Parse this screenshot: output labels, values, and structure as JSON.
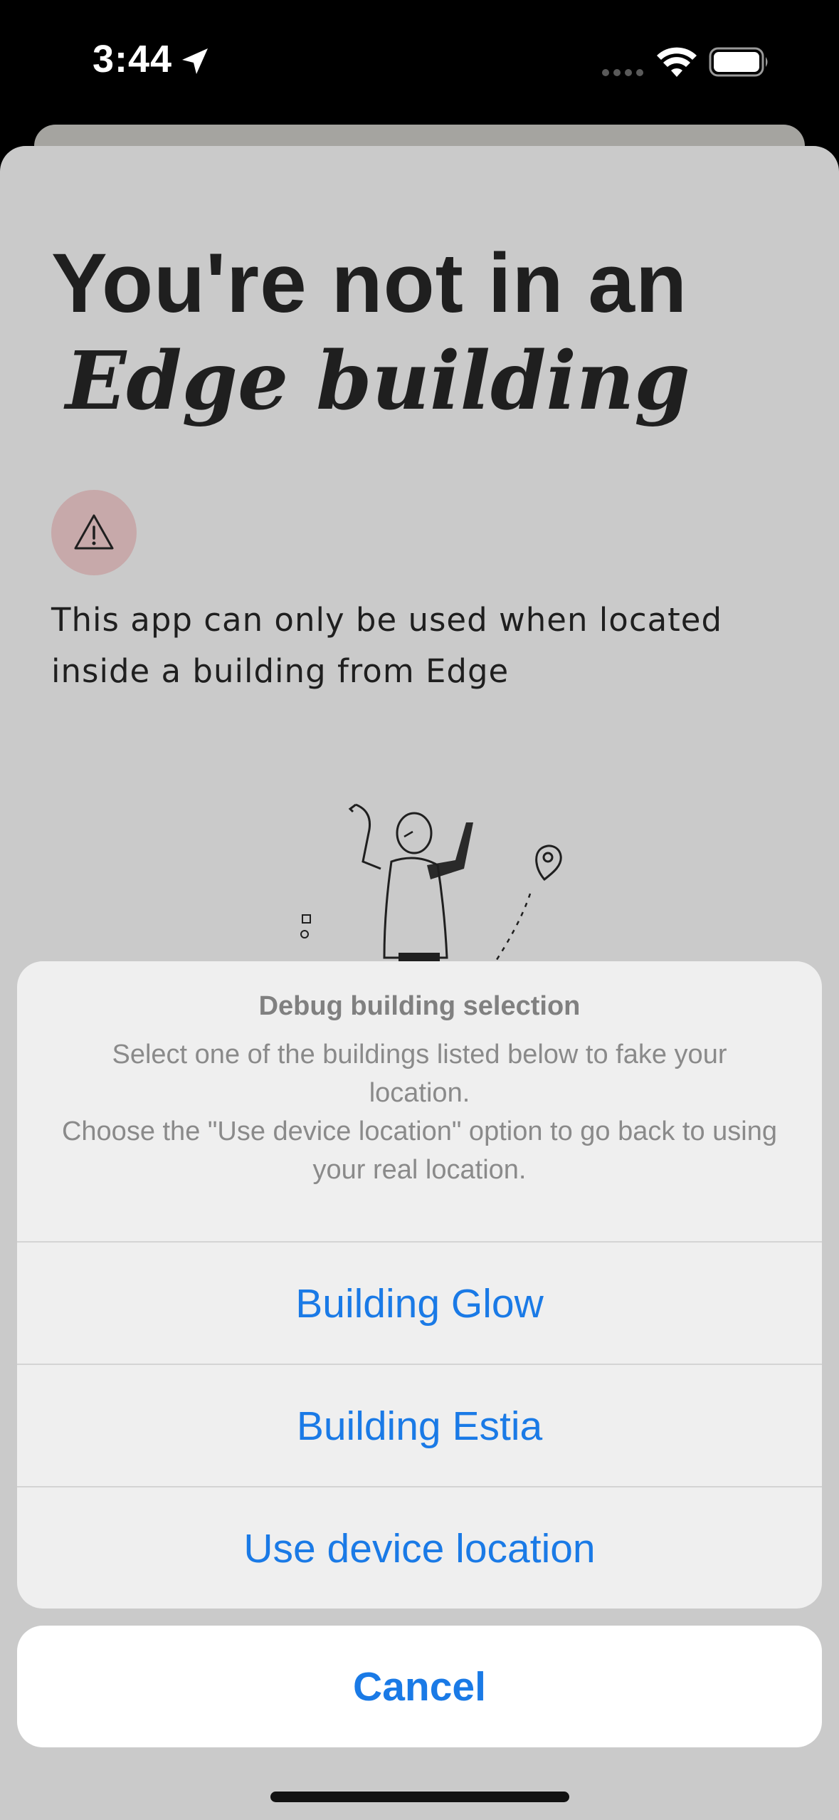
{
  "status_bar": {
    "time": "3:44"
  },
  "main": {
    "headline_line1": "You're not in an",
    "headline_line2": "Edge building",
    "warning_icon": "warning-triangle-icon",
    "info_text": "This app can only be used when located inside a building from Edge",
    "illustration": "person-shrugging-with-location-pin-illustration"
  },
  "action_sheet": {
    "title": "Debug building selection",
    "message_line1": "Select one of the buildings listed below to fake your location.",
    "message_line2": "Choose the \"Use device location\" option to go back to using your real location.",
    "options": [
      {
        "label": "Building Glow"
      },
      {
        "label": "Building Estia"
      },
      {
        "label": "Use device location"
      }
    ],
    "cancel_label": "Cancel"
  },
  "colors": {
    "accent_blue": "#1a7ae6",
    "background_card": "#cacaca",
    "warning_badge": "#c7a9aa"
  }
}
